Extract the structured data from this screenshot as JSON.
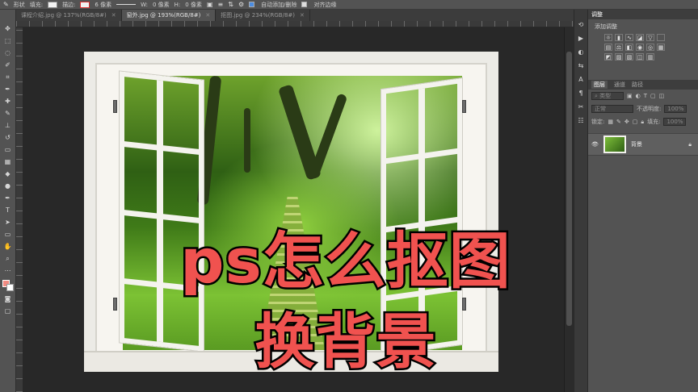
{
  "options_bar": {
    "shape_mode": "形状",
    "fill_label": "填充:",
    "stroke_label": "描边:",
    "stroke_width": "6 像素",
    "w_label": "W:",
    "w_value": "0 像素",
    "h_label": "H:",
    "h_value": "0 像素",
    "auto_add_label": "自动添加/删除",
    "align_edges_label": "对齐边缘",
    "auto_add_checked": true,
    "align_edges_checked": false
  },
  "tabs": [
    {
      "label": "课程介绍.jpg @ 137%(RGB/8#)",
      "active": false
    },
    {
      "label": "窗外.jpg @ 193%(RGB/8#)",
      "active": true
    },
    {
      "label": "抠图.jpg @ 234%(RGB/8#)",
      "active": false
    }
  ],
  "overlay_title": {
    "line1": "ps怎么抠图",
    "line2": "换背景",
    "color": "#f0524f"
  },
  "panels": {
    "adjustments_tab": "调整",
    "adjustments_label": "添加调整",
    "layers_tabs": [
      "图层",
      "通道",
      "路径"
    ],
    "filter_placeholder": "类型",
    "blend_mode": "正常",
    "opacity_label": "不透明度:",
    "opacity_value": "100%",
    "lock_label": "锁定:",
    "fill_label": "填充:",
    "fill_value": "100%",
    "layer_name": "背景"
  },
  "colors": {
    "foreground": "#f28b82",
    "background": "#ffffff"
  }
}
